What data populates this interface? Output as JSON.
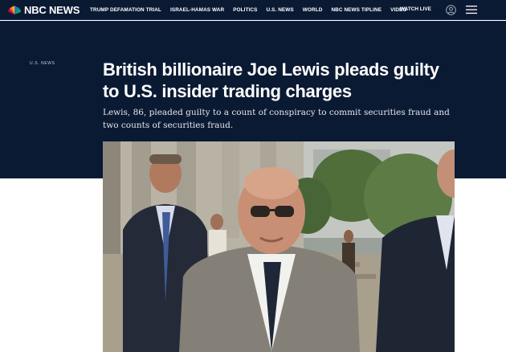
{
  "brand": {
    "name": "NBC NEWS"
  },
  "nav": {
    "links": [
      "TRUMP DEFAMATION TRIAL",
      "ISRAEL-HAMAS WAR",
      "POLITICS",
      "U.S. NEWS",
      "WORLD",
      "NBC NEWS TIPLINE",
      "VIDEO"
    ],
    "watch_live": "WATCH LIVE",
    "user_icon": "user-circle-icon",
    "menu_icon": "hamburger-menu-icon"
  },
  "article": {
    "section": "U.S. NEWS",
    "headline": "British billionaire Joe Lewis pleads guilty to U.S. insider trading charges",
    "dek": "Lewis, 86, pleaded guilty to a count of conspiracy to commit securities fraud and two counts of securities fraud."
  },
  "colors": {
    "header_bg": "#0b1a33",
    "text_white": "#ffffff"
  }
}
